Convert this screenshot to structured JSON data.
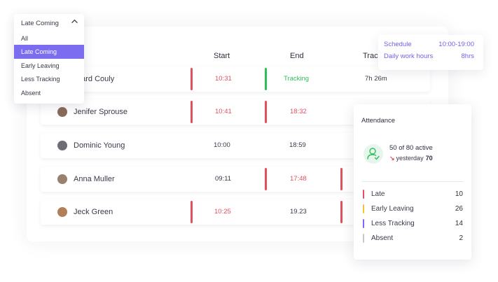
{
  "table": {
    "columns": {
      "start": "Start",
      "end": "End",
      "tracking": "Trac"
    },
    "rows": [
      {
        "name": "uard Couly",
        "start": "10:31",
        "end": "Tracking",
        "tracking": "7h 26m"
      },
      {
        "name": "Jenifer Sprouse",
        "start": "10:41",
        "end": "18:32",
        "tracking": ""
      },
      {
        "name": "Dominic Young",
        "start": "10:00",
        "end": "18:59",
        "tracking": ""
      },
      {
        "name": "Anna Muller",
        "start": "09:11",
        "end": "17:48",
        "tracking": ""
      },
      {
        "name": "Jeck Green",
        "start": "10:25",
        "end": "19.23",
        "tracking": ""
      }
    ]
  },
  "filter": {
    "selected": "Late Coming",
    "options": [
      "All",
      "Late Coming",
      "Early Leaving",
      "Less Tracking",
      "Absent"
    ]
  },
  "schedule": {
    "schedule_label": "Schedule",
    "schedule_value": "10:00-19:00",
    "hours_label": "Daily work hours",
    "hours_value": "8hrs"
  },
  "attendance": {
    "title": "Attendance",
    "active": "50 of 80 active",
    "yesterday_label": "yesterday",
    "yesterday_value": "70",
    "stats": [
      {
        "label": "Late",
        "value": "10",
        "color": "#e0505e"
      },
      {
        "label": "Early Leaving",
        "value": "26",
        "color": "#f5c33b"
      },
      {
        "label": "Less Tracking",
        "value": "14",
        "color": "#7b6cf0"
      },
      {
        "label": "Absent",
        "value": "2",
        "color": "#c6c6cf"
      }
    ]
  },
  "colors": {
    "accent": "#7b6cf0",
    "late_red": "#e0505e",
    "tracking_green": "#2fbf5a"
  }
}
